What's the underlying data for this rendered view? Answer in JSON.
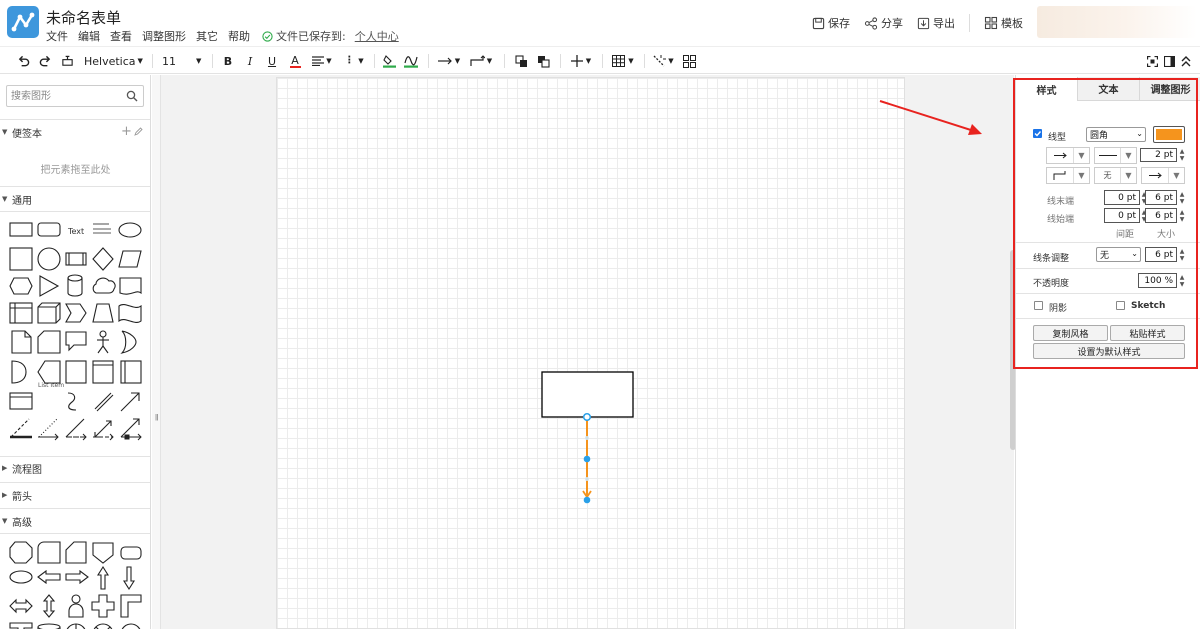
{
  "app": {
    "title": "未命名表单",
    "menu": [
      "文件",
      "编辑",
      "查看",
      "调整图形",
      "其它",
      "帮助"
    ],
    "save_status": "文件已保存到:",
    "save_location": "个人中心"
  },
  "header_actions": {
    "save": "保存",
    "share": "分享",
    "export": "导出",
    "templates": "模板"
  },
  "toolbar": {
    "font_family": "Helvetica",
    "font_size": "11"
  },
  "sidebar": {
    "search_placeholder": "搜索图形",
    "scratchpad": {
      "title": "便签本",
      "empty_hint": "把元素拖至此处"
    },
    "general": {
      "title": "通用",
      "text_shape": "Text",
      "list_item": "List Item"
    },
    "sections": [
      "流程图",
      "箭头",
      "高级"
    ]
  },
  "format_panel": {
    "tabs": [
      "样式",
      "文本",
      "调整图形"
    ],
    "active_tab": "样式",
    "line_type": {
      "label": "线型",
      "checked": true,
      "value": "圆角",
      "color": "#f5941d"
    },
    "line_width": "2 pt",
    "line_end": {
      "label": "线末端",
      "spacing": "0 pt",
      "size": "6 pt"
    },
    "line_start": {
      "label": "线始端",
      "spacing": "0 pt",
      "size": "6 pt"
    },
    "spacing_label": "间距",
    "size_label": "大小",
    "waypoint_label": "无",
    "line_jumps": {
      "label": "线条调整",
      "value": "无",
      "size": "6 pt"
    },
    "opacity": {
      "label": "不透明度",
      "value": "100 %"
    },
    "shadow": {
      "label": "阴影",
      "checked": false
    },
    "sketch": {
      "label": "Sketch",
      "checked": false
    },
    "buttons": {
      "copy_style": "复制风格",
      "paste_style": "粘贴样式",
      "set_default": "设置为默认样式"
    }
  },
  "colors": {
    "accent": "#3e97dc",
    "edge": "#f5941d",
    "handle": "#29a0e8",
    "highlight": "#e8231f"
  }
}
